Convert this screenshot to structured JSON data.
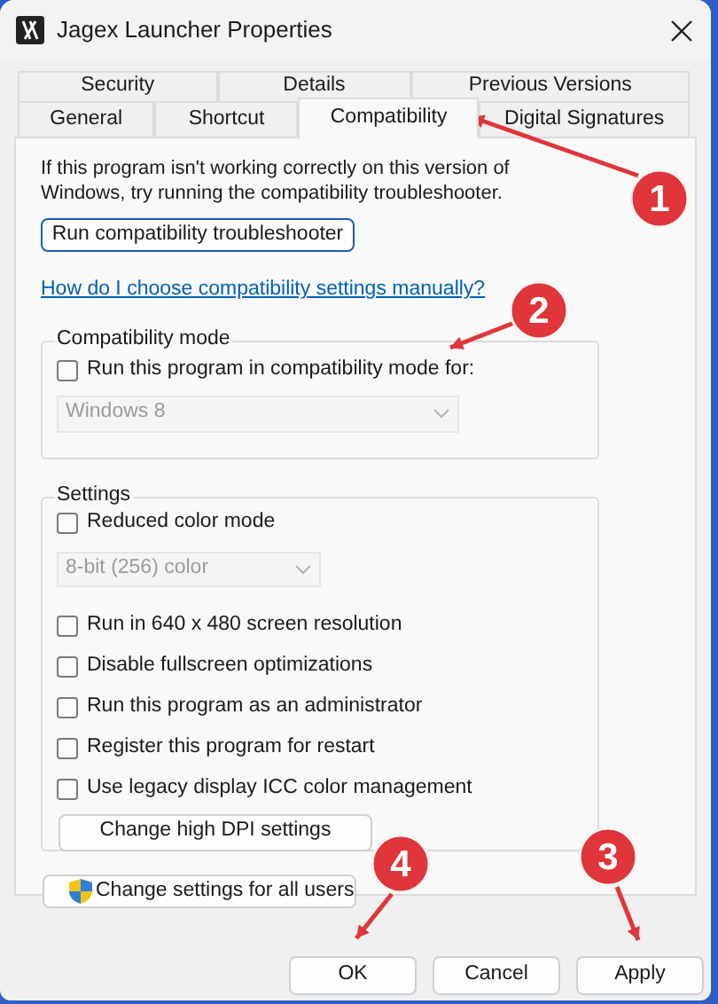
{
  "window": {
    "title": "Jagex Launcher Properties"
  },
  "tabs": [
    [
      {
        "label": "Security",
        "selected": false
      },
      {
        "label": "Details",
        "selected": false
      },
      {
        "label": "Previous Versions",
        "selected": false
      }
    ],
    [
      {
        "label": "General",
        "selected": false
      },
      {
        "label": "Shortcut",
        "selected": false
      },
      {
        "label": "Compatibility",
        "selected": true
      },
      {
        "label": "Digital Signatures",
        "selected": false
      }
    ]
  ],
  "intro": "If this program isn't working correctly on this version of Windows, try running the compatibility troubleshooter.",
  "troubleshooter_button": "Run compatibility troubleshooter",
  "help_link": "How do I choose compatibility settings manually?",
  "compatibility_mode": {
    "title": "Compatibility mode",
    "items": [
      {
        "kind": "checkbox",
        "label": "Run this program in compatibility mode for:",
        "checked": false
      },
      {
        "kind": "dropdown",
        "value": "Windows 8",
        "disabled": true
      }
    ]
  },
  "settings": {
    "title": "Settings",
    "items": [
      {
        "kind": "checkbox",
        "label": "Reduced color mode",
        "checked": false
      },
      {
        "kind": "dropdown",
        "value": "8-bit (256) color",
        "disabled": true
      },
      {
        "kind": "checkbox",
        "label": "Run in 640 x 480 screen resolution",
        "checked": false
      },
      {
        "kind": "checkbox",
        "label": "Disable fullscreen optimizations",
        "checked": false
      },
      {
        "kind": "checkbox",
        "label": "Run this program as an administrator",
        "checked": false
      },
      {
        "kind": "checkbox",
        "label": "Register this program for restart",
        "checked": false
      },
      {
        "kind": "checkbox",
        "label": "Use legacy display ICC color management",
        "checked": false
      },
      {
        "kind": "button",
        "label": "Change high DPI settings"
      }
    ]
  },
  "all_users_button": "Change settings for all users",
  "buttons": [
    "OK",
    "Cancel",
    "Apply"
  ],
  "annotations": [
    {
      "number": "1"
    },
    {
      "number": "2"
    },
    {
      "number": "3"
    },
    {
      "number": "4"
    }
  ]
}
